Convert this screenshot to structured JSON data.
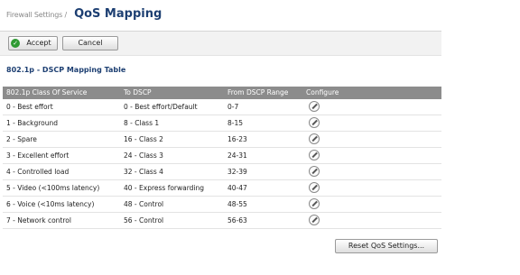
{
  "header": {
    "breadcrumb": "Firewall Settings /",
    "title": "QoS Mapping"
  },
  "toolbar": {
    "accept_label": "Accept",
    "cancel_label": "Cancel"
  },
  "section": {
    "title": "802.1p - DSCP Mapping Table"
  },
  "table": {
    "columns": [
      "802.1p Class Of Service",
      "To DSCP",
      "From DSCP Range",
      "Configure"
    ],
    "rows": [
      {
        "cos": "0 - Best effort",
        "to_dscp": "0 - Best effort/Default",
        "range": "0-7"
      },
      {
        "cos": "1 - Background",
        "to_dscp": "8 - Class 1",
        "range": "8-15"
      },
      {
        "cos": "2 - Spare",
        "to_dscp": "16 - Class 2",
        "range": "16-23"
      },
      {
        "cos": "3 - Excellent effort",
        "to_dscp": "24 - Class 3",
        "range": "24-31"
      },
      {
        "cos": "4 - Controlled load",
        "to_dscp": "32 - Class 4",
        "range": "32-39"
      },
      {
        "cos": "5 - Video (<100ms latency)",
        "to_dscp": "40 - Express forwarding",
        "range": "40-47"
      },
      {
        "cos": "6 - Voice (<10ms latency)",
        "to_dscp": "48 - Control",
        "range": "48-55"
      },
      {
        "cos": "7 - Network control",
        "to_dscp": "56 - Control",
        "range": "56-63"
      }
    ]
  },
  "footer": {
    "reset_label": "Reset QoS Settings..."
  },
  "icons": {
    "accept": "check-icon",
    "configure": "pencil-edit-icon"
  },
  "colors": {
    "title": "#1d3f72",
    "table_header_bg": "#8c8c8c",
    "accept_icon": "#2e9a32"
  }
}
